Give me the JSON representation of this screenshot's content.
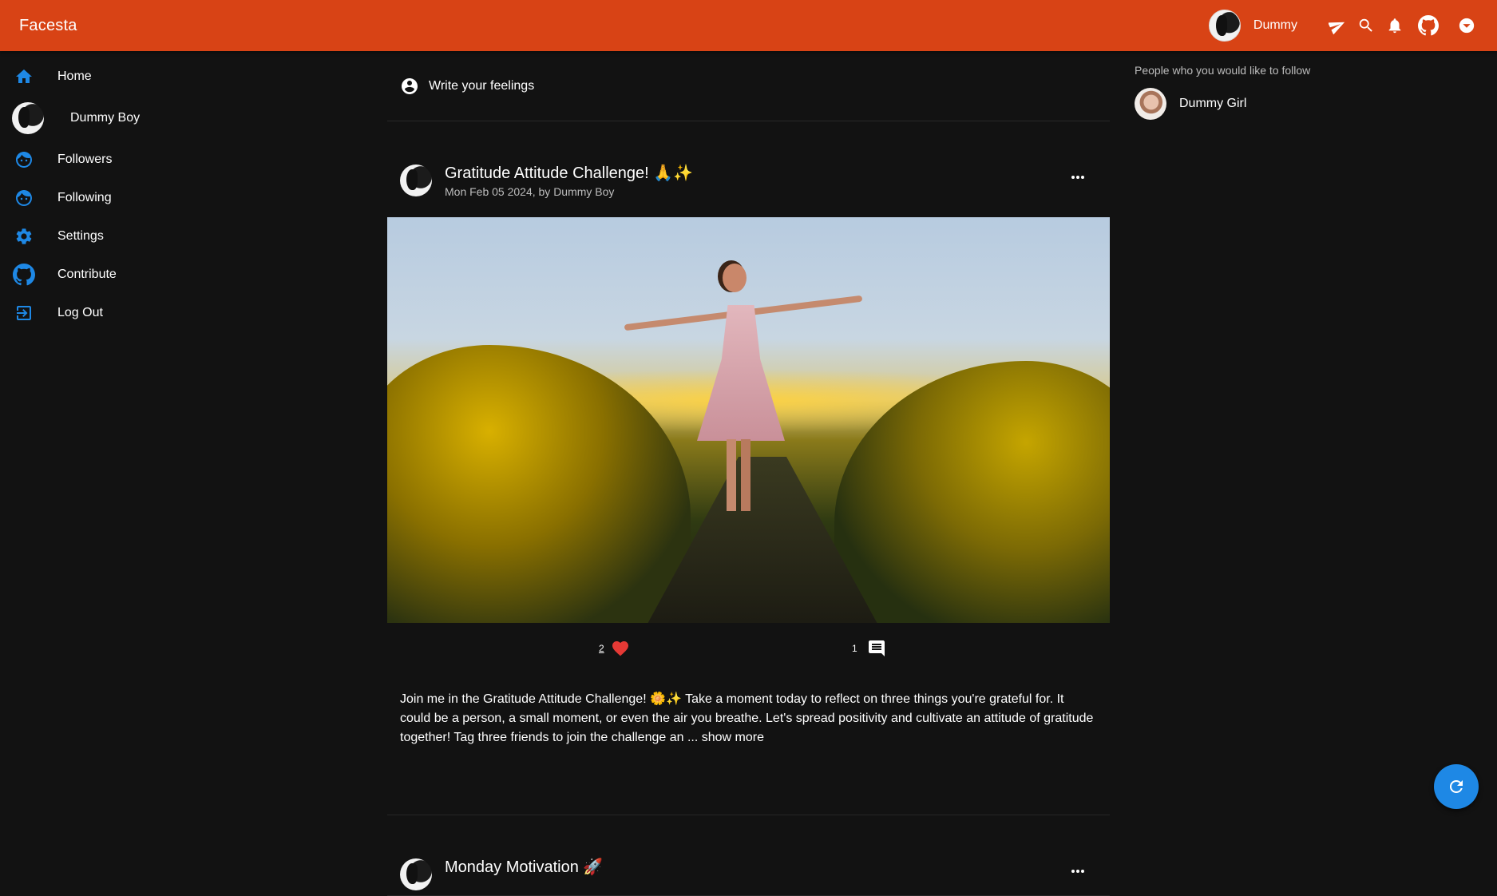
{
  "app": {
    "title": "Facesta",
    "accent_color": "#d84315",
    "link_color": "#1e88e5"
  },
  "appbar": {
    "username": "Dummy",
    "icons": [
      "send-icon",
      "search-icon",
      "bell-icon",
      "github-icon",
      "chevron-down-icon"
    ]
  },
  "sidebar": {
    "items": [
      {
        "label": "Home",
        "icon": "home-icon"
      },
      {
        "label": "Dummy Boy",
        "icon": "avatar"
      },
      {
        "label": "Followers",
        "icon": "face-icon"
      },
      {
        "label": "Following",
        "icon": "face-icon"
      },
      {
        "label": "Settings",
        "icon": "gear-icon"
      },
      {
        "label": "Contribute",
        "icon": "github-icon"
      },
      {
        "label": "Log Out",
        "icon": "logout-icon"
      }
    ]
  },
  "composer": {
    "placeholder": "Write your feelings"
  },
  "posts": [
    {
      "title": "Gratitude Attitude Challenge! 🙏✨",
      "meta": "Mon Feb 05 2024, by Dummy Boy",
      "likes": "2",
      "comments": "1",
      "body": "Join me in the Gratitude Attitude Challenge! 🌼✨ Take a moment today to reflect on three things you're grateful for. It could be a person, a small moment, or even the air you breathe. Let's spread positivity and cultivate an attitude of gratitude together! Tag three friends to join the challenge an ...",
      "show_more": "show more"
    },
    {
      "title": "Monday Motivation 🚀"
    }
  ],
  "suggestions": {
    "title": "People who you would like to follow",
    "people": [
      {
        "name": "Dummy Girl"
      }
    ]
  }
}
